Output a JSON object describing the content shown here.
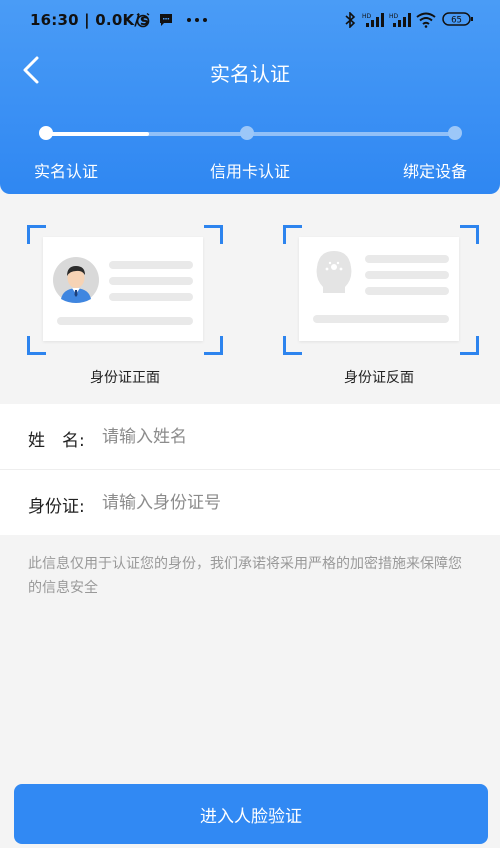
{
  "status_bar": {
    "time": "16:30",
    "speed": "0.0K/s",
    "battery": "65",
    "icons": [
      "alarm-icon",
      "message-icon",
      "more-dots-icon",
      "bluetooth-icon",
      "signal-hd-icon",
      "signal-hd-icon",
      "wifi-icon",
      "battery-icon"
    ]
  },
  "header": {
    "title": "实名认证",
    "back_icon": "chevron-left-icon",
    "accent_color": "#2f87f2"
  },
  "steps": {
    "items": [
      {
        "label": "实名认证",
        "state": "active"
      },
      {
        "label": "信用卡认证",
        "state": "pending"
      },
      {
        "label": "绑定设备",
        "state": "pending"
      }
    ],
    "progress": 0.25
  },
  "id_cards": [
    {
      "caption": "身份证正面",
      "icon": "avatar-portrait-icon"
    },
    {
      "caption": "身份证反面",
      "icon": "national-emblem-icon"
    }
  ],
  "form": {
    "name": {
      "label": "姓　名:",
      "placeholder": "请输入姓名",
      "value": ""
    },
    "id_number": {
      "label": "身份证:",
      "placeholder": "请输入身份证号",
      "value": ""
    }
  },
  "notice": "此信息仅用于认证您的身份，我们承诺将采用严格的加密措施来保障您的信息安全",
  "submit_label": "进入人脸验证"
}
